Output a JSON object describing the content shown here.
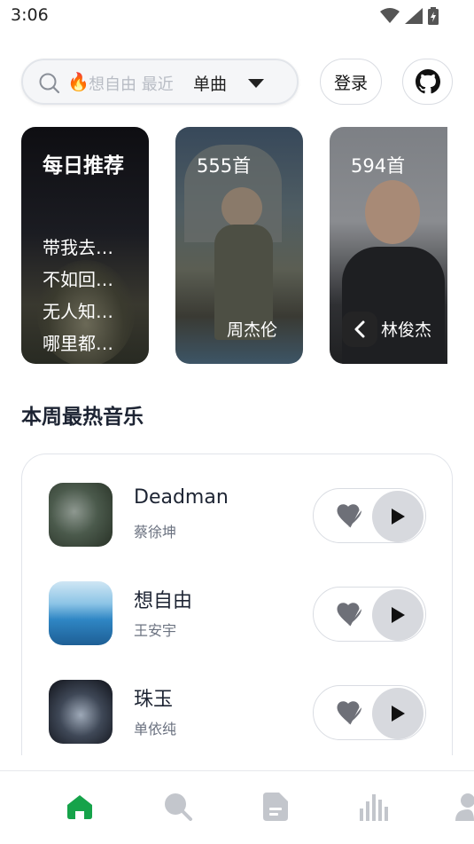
{
  "status_bar": {
    "time": "3:06"
  },
  "search": {
    "placeholder": "想自由 最近",
    "fire_icon": "🔥",
    "mode": "单曲"
  },
  "header": {
    "login_label": "登录"
  },
  "cards": {
    "daily": {
      "title": "每日推荐",
      "songs": [
        "带我去…",
        "不如回…",
        "无人知…",
        "哪里都…"
      ]
    },
    "jay": {
      "count": "555首",
      "artist": "周杰伦"
    },
    "jj": {
      "count": "594首",
      "artist": "林俊杰"
    }
  },
  "section": {
    "title": "本周最热音乐"
  },
  "songs": [
    {
      "name": "Deadman",
      "singer": "蔡徐坤"
    },
    {
      "name": "想自由",
      "singer": "王安宇"
    },
    {
      "name": "珠玉",
      "singer": "单依纯"
    }
  ],
  "nav": {
    "items": [
      "home-icon",
      "search-icon",
      "document-icon",
      "chart-icon",
      "user-icon"
    ],
    "active_color": "#16a34a",
    "inactive_color": "#c3c6cc"
  }
}
